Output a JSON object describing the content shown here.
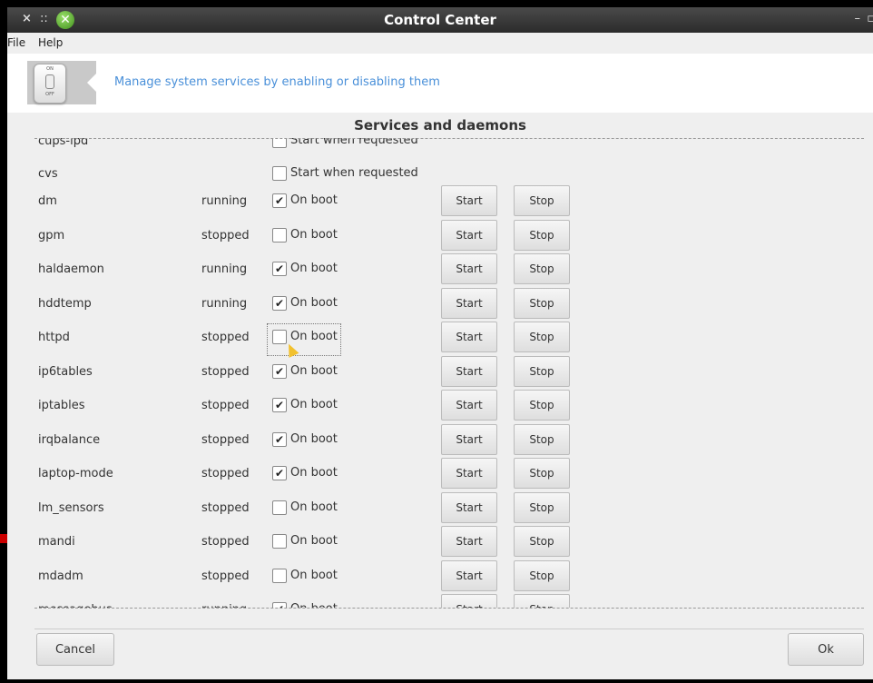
{
  "window": {
    "title": "Control Center",
    "close_glyph": "×",
    "menu_glyph": "::",
    "min_glyph": "–",
    "max_glyph": "▫",
    "logo_glyph": "✕"
  },
  "menubar": {
    "items": [
      "File",
      "Help"
    ]
  },
  "banner": {
    "text": "Manage system services by enabling or disabling them",
    "icon": "on-off-switch-icon",
    "icon_on": "ON",
    "icon_off": "OFF"
  },
  "heading": "Services and daemons",
  "checkmark": "✔",
  "services": [
    {
      "name": "cups-lpd",
      "status": "",
      "option": "Start when requested",
      "checked": false,
      "buttons": false
    },
    {
      "name": "cvs",
      "status": "",
      "option": "Start when requested",
      "checked": false,
      "buttons": false
    },
    {
      "name": "dm",
      "status": "running",
      "option": "On boot",
      "checked": true,
      "buttons": true
    },
    {
      "name": "gpm",
      "status": "stopped",
      "option": "On boot",
      "checked": false,
      "buttons": true
    },
    {
      "name": "haldaemon",
      "status": "running",
      "option": "On boot",
      "checked": true,
      "buttons": true
    },
    {
      "name": "hddtemp",
      "status": "running",
      "option": "On boot",
      "checked": true,
      "buttons": true
    },
    {
      "name": "httpd",
      "status": "stopped",
      "option": "On boot",
      "checked": false,
      "buttons": true,
      "focused": true
    },
    {
      "name": "ip6tables",
      "status": "stopped",
      "option": "On boot",
      "checked": true,
      "buttons": true
    },
    {
      "name": "iptables",
      "status": "stopped",
      "option": "On boot",
      "checked": true,
      "buttons": true
    },
    {
      "name": "irqbalance",
      "status": "stopped",
      "option": "On boot",
      "checked": true,
      "buttons": true
    },
    {
      "name": "laptop-mode",
      "status": "stopped",
      "option": "On boot",
      "checked": true,
      "buttons": true
    },
    {
      "name": "lm_sensors",
      "status": "stopped",
      "option": "On boot",
      "checked": false,
      "buttons": true
    },
    {
      "name": "mandi",
      "status": "stopped",
      "option": "On boot",
      "checked": false,
      "buttons": true
    },
    {
      "name": "mdadm",
      "status": "stopped",
      "option": "On boot",
      "checked": false,
      "buttons": true
    },
    {
      "name": "messagebus",
      "status": "running",
      "option": "On boot",
      "checked": true,
      "buttons": true
    }
  ],
  "labels": {
    "start": "Start",
    "stop": "Stop"
  },
  "footer": {
    "cancel": "Cancel",
    "ok": "Ok"
  },
  "colors": {
    "accent": "#4a90d9",
    "titlebar": "#2b2b2b"
  }
}
